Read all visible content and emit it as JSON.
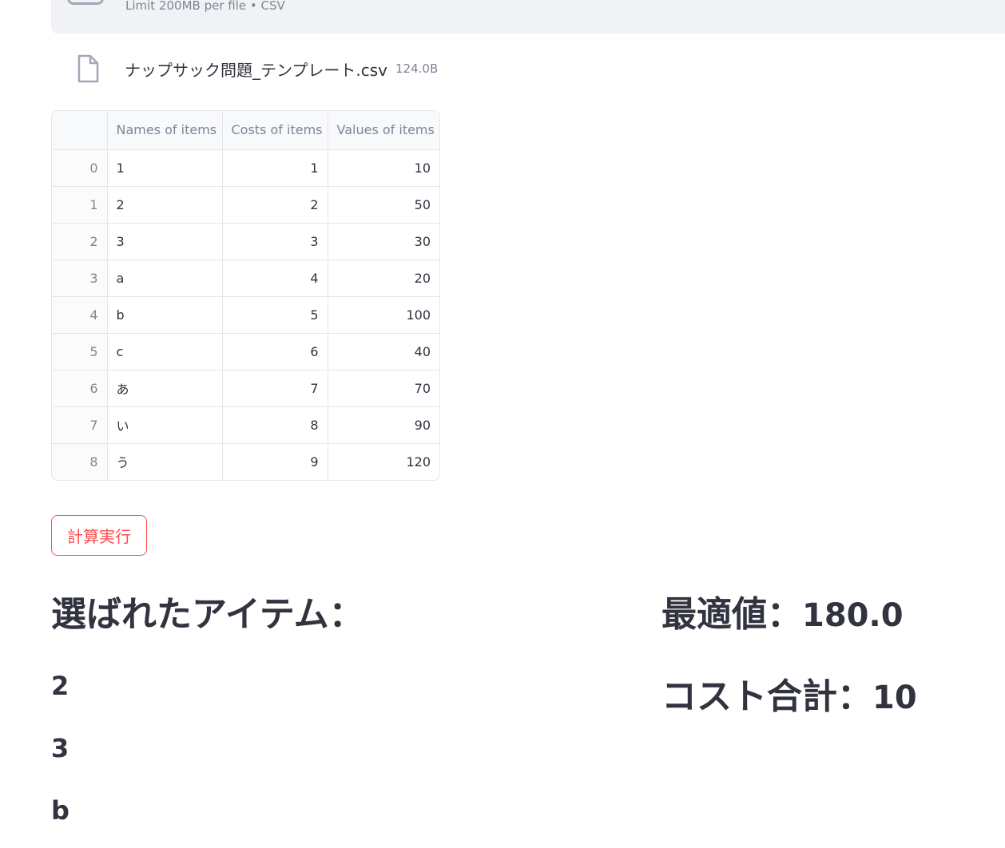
{
  "upload": {
    "limit_text": "Limit 200MB per file • CSV",
    "file_name": "ナップサック問題_テンプレート.csv",
    "file_size": "124.0B"
  },
  "table": {
    "columns": [
      "",
      "Names of items",
      "Costs of items",
      "Values of items"
    ],
    "rows": [
      {
        "index": "0",
        "name": "1",
        "cost": "1",
        "value": "10"
      },
      {
        "index": "1",
        "name": "2",
        "cost": "2",
        "value": "50"
      },
      {
        "index": "2",
        "name": "3",
        "cost": "3",
        "value": "30"
      },
      {
        "index": "3",
        "name": "a",
        "cost": "4",
        "value": "20"
      },
      {
        "index": "4",
        "name": "b",
        "cost": "5",
        "value": "100"
      },
      {
        "index": "5",
        "name": "c",
        "cost": "6",
        "value": "40"
      },
      {
        "index": "6",
        "name": "あ",
        "cost": "7",
        "value": "70"
      },
      {
        "index": "7",
        "name": "い",
        "cost": "8",
        "value": "90"
      },
      {
        "index": "8",
        "name": "う",
        "cost": "9",
        "value": "120"
      }
    ]
  },
  "run_button": {
    "label": "計算実行"
  },
  "results": {
    "selected_heading": "選ばれたアイテム：",
    "selected_items": [
      "2",
      "3",
      "b"
    ],
    "optimal_label": "最適値：",
    "optimal_value": "180.0",
    "cost_label": "コスト合計：",
    "cost_value": "10"
  },
  "colors": {
    "accent": "#ff4b4b",
    "text": "#31333f",
    "muted": "#808495",
    "dropzone_bg": "#f0f2f6"
  }
}
